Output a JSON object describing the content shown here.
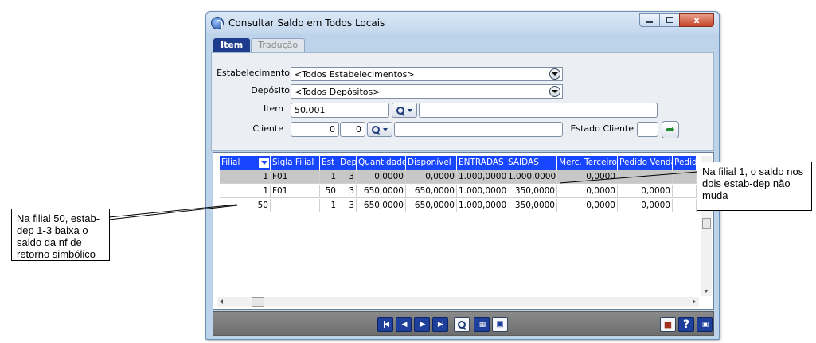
{
  "window": {
    "title": "Consultar Saldo em Todos Locais",
    "close_label": "x"
  },
  "tabs": [
    {
      "label": "Item",
      "active": true
    },
    {
      "label": "Tradução",
      "active": false
    }
  ],
  "form": {
    "estabelecimento_label": "Estabelecimento",
    "estabelecimento_value": "<Todos Estabelecimentos>",
    "deposito_label": "Depósito",
    "deposito_value": "<Todos Depósitos>",
    "item_label": "Item",
    "item_value": "50.001",
    "item_desc": "",
    "cliente_label": "Cliente",
    "cliente_value1": "0",
    "cliente_value2": "0",
    "cliente_name": "",
    "estado_cliente_label": "Estado Cliente",
    "estado_cliente_value": ""
  },
  "grid": {
    "columns": [
      "Filial",
      "Sigla Filial",
      "Est",
      "Dep",
      "Quantidade",
      "Disponível",
      "ENTRADAS",
      "SAIDAS",
      "Merc. Terceiros",
      "Pedido Venda",
      "Pedido"
    ],
    "rows": [
      [
        "1",
        "F01",
        "1",
        "3",
        "0,0000",
        "0,0000",
        "1.000,0000",
        "1.000,0000",
        "0,0000",
        "",
        ""
      ],
      [
        "1",
        "F01",
        "50",
        "3",
        "650,0000",
        "650,0000",
        "1.000,0000",
        "350,0000",
        "0,0000",
        "0,0000",
        ""
      ],
      [
        "50",
        "",
        "1",
        "3",
        "650,0000",
        "650,0000",
        "1.000,0000",
        "350,0000",
        "0,0000",
        "0,0000",
        ""
      ]
    ]
  },
  "callouts": {
    "left": "Na filial 50, estab-dep 1-3 baixa o saldo da nf de retorno simbólico",
    "right": "Na filial 1, o saldo nos dois estab-dep não muda"
  },
  "colors": {
    "header_blue": "#1846ff",
    "window_frame": "#bcd3ea",
    "selected_row": "#c7c7c7"
  }
}
